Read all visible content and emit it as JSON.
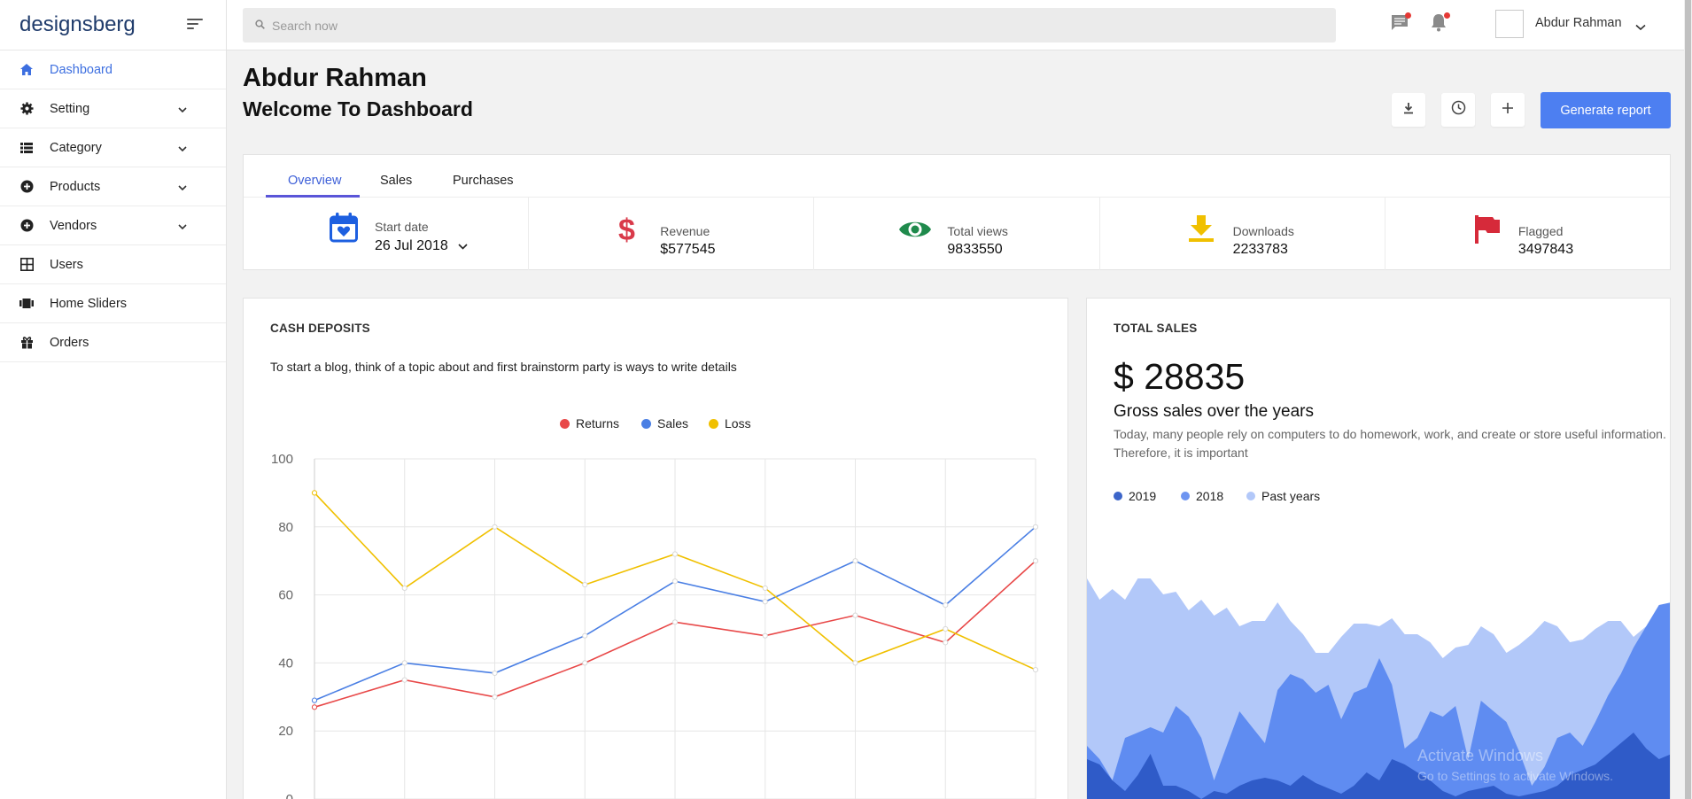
{
  "sidebar": {
    "brand": "designsberg",
    "items": [
      {
        "label": "Dashboard",
        "icon": "home-icon",
        "active": true,
        "has_children": false
      },
      {
        "label": "Setting",
        "icon": "gear-icon",
        "active": false,
        "has_children": true
      },
      {
        "label": "Category",
        "icon": "list-icon",
        "active": false,
        "has_children": true
      },
      {
        "label": "Products",
        "icon": "plus-circle-icon",
        "active": false,
        "has_children": true
      },
      {
        "label": "Vendors",
        "icon": "plus-circle-icon",
        "active": false,
        "has_children": true
      },
      {
        "label": "Users",
        "icon": "grid-icon",
        "active": false,
        "has_children": false
      },
      {
        "label": "Home Sliders",
        "icon": "slides-icon",
        "active": false,
        "has_children": false
      },
      {
        "label": "Orders",
        "icon": "gift-icon",
        "active": false,
        "has_children": false
      }
    ]
  },
  "topbar": {
    "search_placeholder": "Search now",
    "user_name": "Abdur Rahman"
  },
  "header": {
    "title": "Abdur Rahman",
    "subtitle": "Welcome To Dashboard",
    "generate_label": "Generate report"
  },
  "tabs": [
    "Overview",
    "Sales",
    "Purchases"
  ],
  "stats": {
    "start_date": {
      "label": "Start date",
      "value": "26 Jul 2018"
    },
    "revenue": {
      "label": "Revenue",
      "value": "$577545"
    },
    "views": {
      "label": "Total views",
      "value": "9833550"
    },
    "downloads": {
      "label": "Downloads",
      "value": "2233783"
    },
    "flagged": {
      "label": "Flagged",
      "value": "3497843"
    }
  },
  "cash_deposits": {
    "title": "CASH DEPOSITS",
    "description": "To start a blog, think of a topic about and first brainstorm party is ways to write details"
  },
  "total_sales": {
    "title": "TOTAL SALES",
    "amount": "$ 28835",
    "heading": "Gross sales over the years",
    "description": "Today, many people rely on computers to do homework, work, and create or store useful information. Therefore, it is important",
    "legend": [
      "2019",
      "2018",
      "Past years"
    ]
  },
  "colors": {
    "accent": "#4d7ff1",
    "returns": "#e84848",
    "sales": "#4a7fe4",
    "loss": "#f0c000",
    "area_2019": "#2f5bc8",
    "area_2018": "#5f8cf1",
    "area_past": "#b2c8f9"
  },
  "watermark": {
    "title": "Activate Windows",
    "subtitle": "Go to Settings to activate Windows."
  },
  "chart_data": [
    {
      "type": "line",
      "x": [
        0,
        1,
        2,
        3,
        4,
        5,
        6,
        7,
        8
      ],
      "series": [
        {
          "name": "Returns",
          "values": [
            27,
            35,
            30,
            40,
            52,
            48,
            54,
            46,
            70
          ]
        },
        {
          "name": "Sales",
          "values": [
            29,
            40,
            37,
            48,
            64,
            58,
            70,
            57,
            80
          ]
        },
        {
          "name": "Loss",
          "values": [
            90,
            62,
            80,
            63,
            72,
            62,
            40,
            50,
            38
          ]
        }
      ],
      "y_ticks": [
        "100",
        "80",
        "60",
        "40",
        "20",
        "0"
      ],
      "ylim": [
        0,
        100
      ],
      "grid": true,
      "legend_placement": "top-center"
    },
    {
      "type": "area",
      "series": [
        {
          "name": "Past years",
          "values": [
            88,
            80,
            84,
            80,
            88,
            88,
            82,
            83,
            76,
            80,
            74,
            77,
            70,
            72,
            72,
            79,
            72,
            67,
            60,
            60,
            66,
            71,
            71,
            70,
            73,
            67,
            67,
            64,
            58,
            62,
            63,
            70,
            67,
            60,
            63,
            67,
            72,
            70,
            64,
            65,
            69,
            72,
            72,
            66,
            70,
            73,
            72
          ]
        },
        {
          "name": "2018",
          "values": [
            25,
            20,
            12,
            28,
            30,
            32,
            30,
            40,
            36,
            28,
            12,
            25,
            38,
            32,
            26,
            46,
            52,
            50,
            45,
            48,
            35,
            45,
            47,
            58,
            48,
            24,
            28,
            38,
            36,
            40,
            20,
            42,
            38,
            34,
            23,
            10,
            17,
            28,
            30,
            25,
            34,
            44,
            52,
            62,
            70,
            78,
            79
          ]
        },
        {
          "name": "2019",
          "values": [
            20,
            18,
            12,
            8,
            14,
            22,
            10,
            10,
            8,
            5,
            8,
            7,
            10,
            12,
            13,
            12,
            10,
            14,
            11,
            9,
            7,
            10,
            15,
            12,
            20,
            18,
            15,
            12,
            8,
            6,
            8,
            9,
            10,
            7,
            6,
            7,
            8,
            10,
            14,
            16,
            18,
            22,
            26,
            30,
            24,
            20,
            22
          ]
        }
      ],
      "ylim": [
        0,
        100
      ],
      "legend_placement": "top-left"
    }
  ]
}
